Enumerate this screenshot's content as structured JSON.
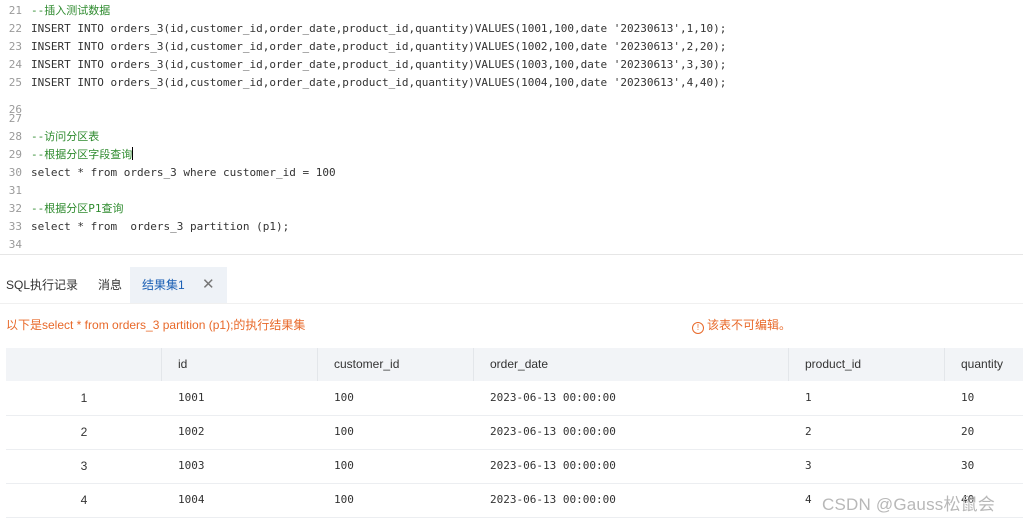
{
  "editor": {
    "lines": [
      {
        "n": "21",
        "t": "--插入测试数据"
      },
      {
        "n": "22",
        "t": "INSERT INTO orders_3(id,customer_id,order_date,product_id,quantity)VALUES(1001,100,date '20230613',1,10);"
      },
      {
        "n": "23",
        "t": "INSERT INTO orders_3(id,customer_id,order_date,product_id,quantity)VALUES(1002,100,date '20230613',2,20);"
      },
      {
        "n": "24",
        "t": "INSERT INTO orders_3(id,customer_id,order_date,product_id,quantity)VALUES(1003,100,date '20230613',3,30);"
      },
      {
        "n": "25",
        "t": "INSERT INTO orders_3(id,customer_id,order_date,product_id,quantity)VALUES(1004,100,date '20230613',4,40);"
      },
      {
        "n": "26",
        "t": ""
      },
      {
        "n": "27",
        "t": ""
      },
      {
        "n": "28",
        "t": "--访问分区表"
      },
      {
        "n": "29",
        "t": "--根据分区字段查询"
      },
      {
        "n": "30",
        "t": "select * from orders_3 where customer_id = 100"
      },
      {
        "n": "31",
        "t": ""
      },
      {
        "n": "32",
        "t": "--根据分区P1查询"
      },
      {
        "n": "33",
        "t": "select * from  orders_3 partition (p1);"
      },
      {
        "n": "34",
        "t": ""
      }
    ]
  },
  "tabs": {
    "history": "SQL执行记录",
    "messages": "消息",
    "result": "结果集1",
    "close": "✕"
  },
  "info": {
    "left": "以下是select * from orders_3 partition (p1);的执行结果集",
    "right": "该表不可编辑。",
    "warn_icon": "!"
  },
  "table": {
    "columns": [
      "id",
      "customer_id",
      "order_date",
      "product_id",
      "quantity"
    ],
    "rows": [
      {
        "no": "1",
        "id": "1001",
        "customer_id": "100",
        "order_date": "2023-06-13 00:00:00",
        "product_id": "1",
        "quantity": "10"
      },
      {
        "no": "2",
        "id": "1002",
        "customer_id": "100",
        "order_date": "2023-06-13 00:00:00",
        "product_id": "2",
        "quantity": "20"
      },
      {
        "no": "3",
        "id": "1003",
        "customer_id": "100",
        "order_date": "2023-06-13 00:00:00",
        "product_id": "3",
        "quantity": "30"
      },
      {
        "no": "4",
        "id": "1004",
        "customer_id": "100",
        "order_date": "2023-06-13 00:00:00",
        "product_id": "4",
        "quantity": "40"
      }
    ]
  },
  "watermark": "CSDN @Gauss松鼠会"
}
